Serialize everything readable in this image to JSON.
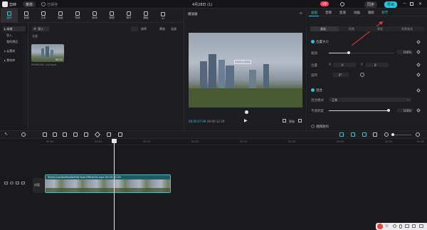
{
  "titlebar": {
    "app_name": "剪映",
    "menu_label": "菜单",
    "autosave_text": "已保存",
    "project_title": "4月28日 (1)",
    "vip_label": "VIP",
    "sync_label": "同步",
    "export_label": "导出"
  },
  "toolbar": {
    "tools": [
      {
        "label": "媒体",
        "icon": "media-icon"
      },
      {
        "label": "音频",
        "icon": "audio-icon"
      },
      {
        "label": "文本",
        "icon": "text-icon"
      },
      {
        "label": "贴纸",
        "icon": "sticker-icon"
      },
      {
        "label": "特效",
        "icon": "effect-icon"
      },
      {
        "label": "转场",
        "icon": "transition-icon"
      },
      {
        "label": "滤镜",
        "icon": "filter-icon"
      },
      {
        "label": "调节",
        "icon": "adjust-icon"
      },
      {
        "label": "模板",
        "icon": "template-icon"
      },
      {
        "label": "AI",
        "icon": "ai-icon"
      }
    ]
  },
  "leftnav": {
    "items": [
      {
        "label": "▸ 本地"
      },
      {
        "label": "导入"
      },
      {
        "label": "我的预设"
      },
      {
        "label": "▸ 云素材"
      },
      {
        "label": "▸ 素材库"
      }
    ]
  },
  "media": {
    "import_label": "导入",
    "section_label": "全部",
    "view_all": "全部",
    "sort_label": "排序",
    "filter_label": "筛选",
    "clip_name": "99a5c2ae...hd.mp4",
    "clip_duration": "00:12"
  },
  "player": {
    "title": "播放器",
    "time_current": "00:00:07:09",
    "time_total": "00:00:12:29",
    "ratio_label": "原始",
    "fit_label": "比例"
  },
  "props": {
    "tabs": [
      "画面",
      "音频",
      "变速",
      "动画",
      "跟踪",
      "调节"
    ],
    "active_tab": "调节",
    "subtabs": [
      "基础",
      "抠像",
      "蒙版",
      "背景填充"
    ],
    "section_position": "位置大小",
    "scale_label": "缩放",
    "scale_value": "100%",
    "position_label": "位置",
    "pos_x_label": "X",
    "pos_x": "0",
    "pos_y_label": "Y",
    "pos_y": "0",
    "rotate_label": "旋转",
    "rotate_value": "0°",
    "section_blend": "混合",
    "blend_mode_label": "混合模式",
    "blend_mode_value": "正常",
    "opacity_label": "不透明度",
    "opacity_value": "100%",
    "section_stabilize": "视频防抖",
    "scale_level": 0.3,
    "opacity_level": 1.0
  },
  "timeline": {
    "ticks": [
      "00:00",
      "00:05",
      "00:10",
      "00:15",
      "00:20",
      "00:25",
      "00:30",
      "00:35",
      "00:40"
    ],
    "track_label": "封面",
    "clip_title": "99a5c2ae0fa6f4a8b9f9d7b4a7ff9fdc9d.mp4  00:00:12:29"
  },
  "taskbar": {
    "ime_label": "中"
  },
  "colors": {
    "accent": "#28c6d8",
    "clip_bg": "#1d6f78",
    "background": "#1b1b1f"
  }
}
